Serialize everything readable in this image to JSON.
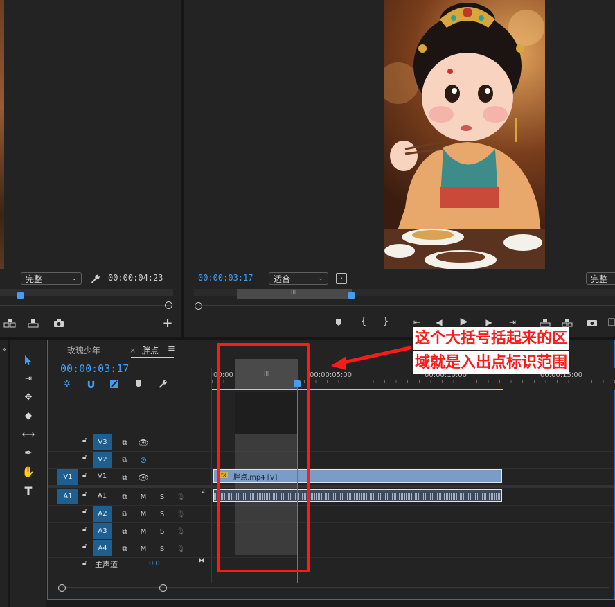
{
  "source_monitor": {
    "quality": "完整",
    "timecode": "00:00:04:23"
  },
  "program_monitor": {
    "timecode": "00:00:03:17",
    "zoom": "适合",
    "quality": "完整",
    "image_desc_icon": "cartoon-girl-eating-image"
  },
  "timeline": {
    "tabs": [
      {
        "label": "玫瑰少年"
      },
      {
        "label": "胖点"
      }
    ],
    "close_symbol": "×",
    "menu_symbol": "≡",
    "timecode": "00:00:03:17",
    "ruler": {
      "labels": [
        "00:00",
        "00:00:05:00",
        "00:00:10:00",
        "00:00:15:00"
      ]
    },
    "tracks": {
      "v3": "V3",
      "v2": "V2",
      "v1_src": "V1",
      "v1": "V1",
      "a1_src": "A1",
      "a1": "A1",
      "a2": "A2",
      "a3": "A3",
      "a4": "A4",
      "m": "M",
      "s": "S",
      "master": "主声道",
      "master_value": "0.0",
      "a1_num": "2"
    },
    "clip_label": "胖点.mp4 [V]",
    "fx_badge": "fx",
    "in_out_marker": "III"
  },
  "annotation": {
    "line1": "这个大括号括起来的区",
    "line2": "域就是入出点标识范围"
  },
  "colors": {
    "accent_blue": "#3f9ef5",
    "annotation_red": "#ff1a1a",
    "clip_blue": "#7a9cc8",
    "track_target": "#1f5f8f"
  }
}
